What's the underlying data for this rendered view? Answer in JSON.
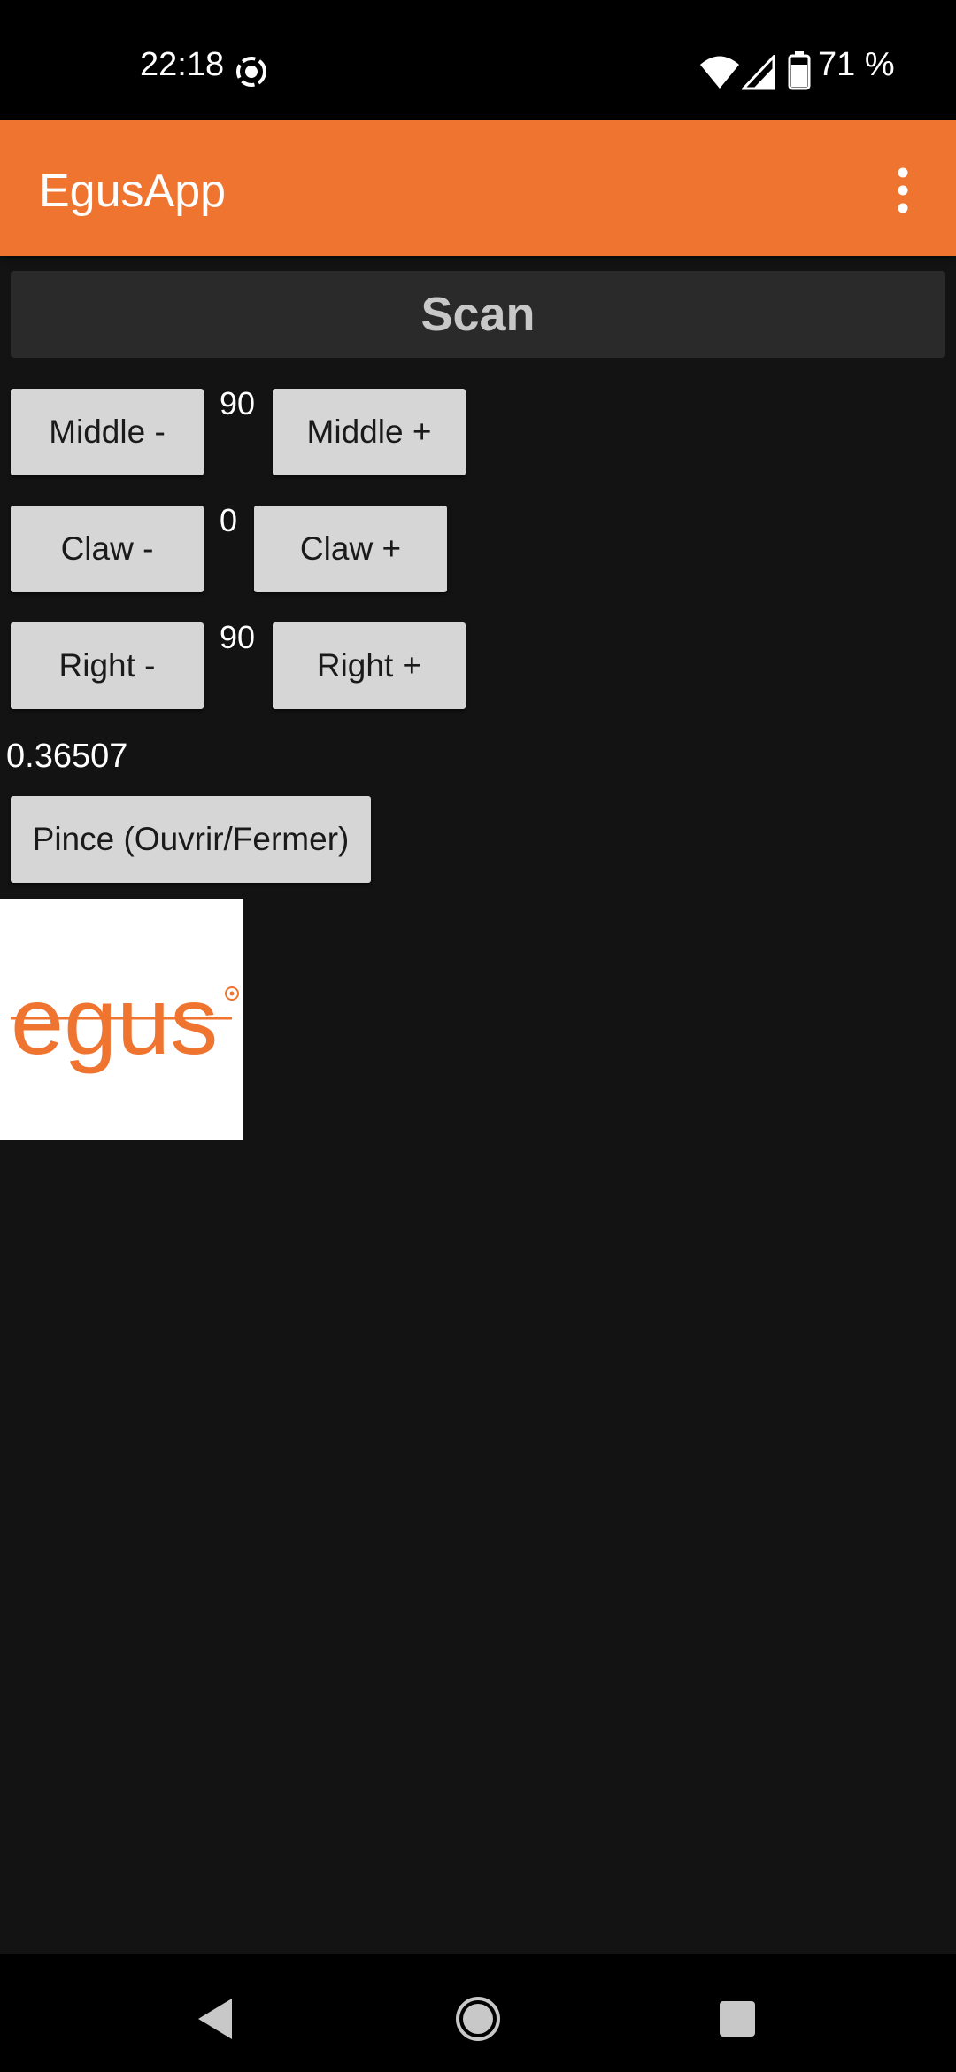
{
  "status_bar": {
    "time": "22:18",
    "battery": "71 %",
    "icons": [
      "record-icon",
      "wifi-icon",
      "signal-icon",
      "battery-icon"
    ]
  },
  "app_bar": {
    "title": "EgusApp",
    "menu_icon": "overflow-menu-icon"
  },
  "scan_label": "Scan",
  "controls": {
    "middle": {
      "minus": "Middle -",
      "value": "90",
      "plus": "Middle +"
    },
    "claw": {
      "minus": "Claw -",
      "value": "0",
      "plus": "Claw +"
    },
    "right": {
      "minus": "Right -",
      "value": "90",
      "plus": "Right +"
    }
  },
  "reading": "0.36507",
  "pince_label": "Pince (Ouvrir/Fermer)",
  "logo_text": "egus",
  "colors": {
    "accent": "#ef7430",
    "background": "#131313",
    "button": "#d6d6d6",
    "scan_button": "#2a2a2a"
  },
  "nav_bar": {
    "icons": [
      "back-icon",
      "home-icon",
      "recents-icon"
    ]
  }
}
